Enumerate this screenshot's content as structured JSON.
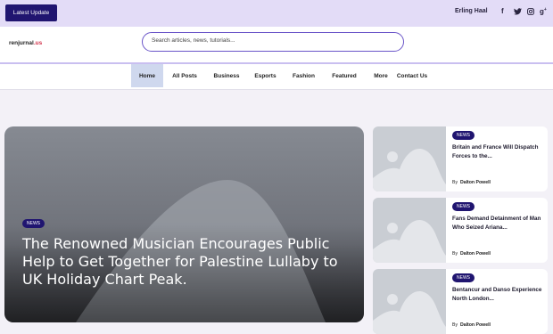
{
  "topbar": {
    "latest_label": "Latest Update",
    "username": "Erling Haal",
    "social": [
      "facebook-icon",
      "twitter-icon",
      "instagram-icon",
      "google-plus-icon"
    ]
  },
  "header": {
    "logo_main": "renjurnal",
    "logo_accent": ".us",
    "search_placeholder": "Search articles, news, tutorials..."
  },
  "nav": {
    "items": [
      "Home",
      "All Posts",
      "Business",
      "Esports",
      "Fashion",
      "Featured",
      "More",
      "Contact Us"
    ],
    "active": "Home"
  },
  "hero": {
    "badge": "NEWS",
    "title": "The Renowned Musician Encourages Public Help to Get Together for Palestine Lullaby to UK Holiday Chart Peak."
  },
  "cards": [
    {
      "badge": "NEWS",
      "title": "Britain and France Will Dispatch Forces to the...",
      "by": "By",
      "author": "Dalton Powell"
    },
    {
      "badge": "NEWS",
      "title": "Fans Demand Detainment of Man Who Seized Ariana...",
      "by": "By",
      "author": "Dalton Powell"
    },
    {
      "badge": "NEWS",
      "title": "Bentancur and Danso Experience North London...",
      "by": "By",
      "author": "Dalton Powell"
    }
  ],
  "colors": {
    "brand": "#201570",
    "topbar": "#e3dcf7",
    "accent": "#d2324a"
  }
}
